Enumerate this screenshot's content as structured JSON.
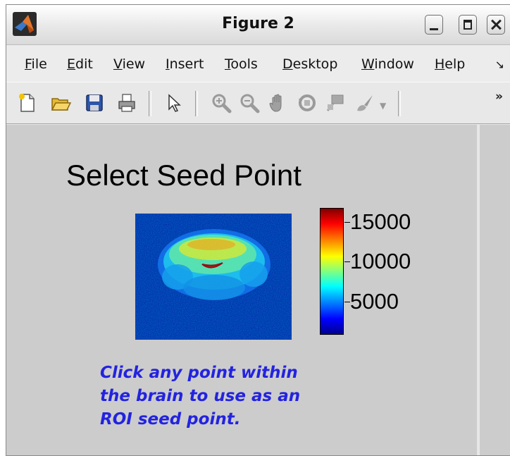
{
  "window": {
    "title": "Figure 2",
    "app_icon": "matlab-logo-icon",
    "controls": [
      "minimize-icon",
      "maximize-icon",
      "close-icon"
    ]
  },
  "menu": {
    "items": [
      {
        "label": "File",
        "mnemonic": "F"
      },
      {
        "label": "Edit",
        "mnemonic": "E"
      },
      {
        "label": "View",
        "mnemonic": "V"
      },
      {
        "label": "Insert",
        "mnemonic": "I"
      },
      {
        "label": "Tools",
        "mnemonic": "T"
      },
      {
        "label": "Desktop",
        "mnemonic": "D"
      },
      {
        "label": "Window",
        "mnemonic": "W"
      },
      {
        "label": "Help",
        "mnemonic": "H"
      }
    ],
    "overflow_icon": "menu-overflow-icon"
  },
  "toolbar": {
    "buttons": [
      "new-figure-icon",
      "open-file-icon",
      "save-icon",
      "print-icon",
      "select-arrow-icon",
      "zoom-in-icon",
      "zoom-out-icon",
      "pan-hand-icon",
      "rotate-3d-icon",
      "data-cursor-icon",
      "brush-icon",
      "dropdown-arrow-icon"
    ],
    "overflow_icon": "toolbar-overflow-icon"
  },
  "figure": {
    "title": "Select Seed Point",
    "colorbar": {
      "ticks": [
        "15000",
        "10000",
        "5000"
      ],
      "colormap": "jet"
    },
    "instruction_lines": [
      "Click any point within",
      "the brain to use as an",
      "ROI seed point."
    ],
    "instruction_color": "#2323e0",
    "background_color": "#cccccc"
  }
}
